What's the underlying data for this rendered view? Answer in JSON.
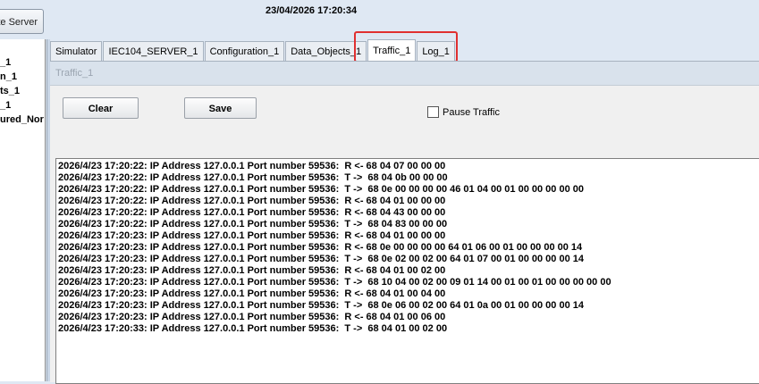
{
  "header": {
    "server_button_label": "te Server",
    "datetime": "23/04/2026 17:20:34"
  },
  "tree": {
    "items": [
      "_1",
      "n_1",
      "ts_1",
      "_1",
      "ured_Nor"
    ]
  },
  "tabs": [
    {
      "label": "Simulator"
    },
    {
      "label": "IEC104_SERVER_1"
    },
    {
      "label": "Configuration_1"
    },
    {
      "label": "Data_Objects_1"
    },
    {
      "label": "Traffic_1"
    },
    {
      "label": "Log_1"
    }
  ],
  "panel": {
    "title": "Traffic_1",
    "clear_label": "Clear",
    "save_label": "Save",
    "pause_label": "Pause Traffic"
  },
  "log": [
    "2026/4/23 17:20:22: IP Address 127.0.0.1 Port number 59536:  R <- 68 04 07 00 00 00",
    "2026/4/23 17:20:22: IP Address 127.0.0.1 Port number 59536:  T ->  68 04 0b 00 00 00",
    "2026/4/23 17:20:22: IP Address 127.0.0.1 Port number 59536:  T ->  68 0e 00 00 00 00 46 01 04 00 01 00 00 00 00 00",
    "2026/4/23 17:20:22: IP Address 127.0.0.1 Port number 59536:  R <- 68 04 01 00 00 00",
    "2026/4/23 17:20:22: IP Address 127.0.0.1 Port number 59536:  R <- 68 04 43 00 00 00",
    "2026/4/23 17:20:22: IP Address 127.0.0.1 Port number 59536:  T ->  68 04 83 00 00 00",
    "2026/4/23 17:20:23: IP Address 127.0.0.1 Port number 59536:  R <- 68 04 01 00 00 00",
    "2026/4/23 17:20:23: IP Address 127.0.0.1 Port number 59536:  R <- 68 0e 00 00 00 00 64 01 06 00 01 00 00 00 00 14",
    "2026/4/23 17:20:23: IP Address 127.0.0.1 Port number 59536:  T ->  68 0e 02 00 02 00 64 01 07 00 01 00 00 00 00 14",
    "2026/4/23 17:20:23: IP Address 127.0.0.1 Port number 59536:  R <- 68 04 01 00 02 00",
    "2026/4/23 17:20:23: IP Address 127.0.0.1 Port number 59536:  T ->  68 10 04 00 02 00 09 01 14 00 01 00 01 00 00 00 00 00",
    "2026/4/23 17:20:23: IP Address 127.0.0.1 Port number 59536:  R <- 68 04 01 00 04 00",
    "2026/4/23 17:20:23: IP Address 127.0.0.1 Port number 59536:  T ->  68 0e 06 00 02 00 64 01 0a 00 01 00 00 00 00 14",
    "2026/4/23 17:20:23: IP Address 127.0.0.1 Port number 59536:  R <- 68 04 01 00 06 00",
    "2026/4/23 17:20:33: IP Address 127.0.0.1 Port number 59536:  T ->  68 04 01 00 02 00"
  ]
}
